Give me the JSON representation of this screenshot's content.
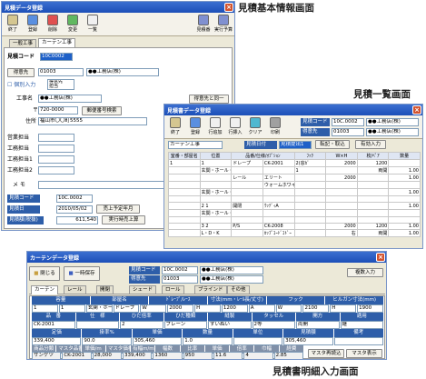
{
  "captions": {
    "master": "見積基本情報画面",
    "list": "見積一覧画面",
    "detail": "見積書明細入力画面"
  },
  "win1": {
    "title": "見積データ登録",
    "toolbar": [
      "終了",
      "登録",
      "削除",
      "変更",
      "一覧"
    ],
    "toolbar_right": [
      "見積番",
      "実行予算"
    ],
    "tabs": [
      "一般工事",
      "カーテン工事"
    ],
    "estimate_label": "見積コード",
    "estimate_value": "10C0002",
    "orderer_label": "得意先",
    "orderer_code": "01003",
    "orderer_name": "●●工務店(株)",
    "ship_label": "個別入力",
    "ship_note": "得意先\n担当",
    "project_label": "工事名",
    "project_value": "●●工務店(株)",
    "same_button": "得意先と同一",
    "zip_prefix": "〒",
    "zip_value": "720-0000",
    "zip_button": "郵便番号検索",
    "addr_label": "住所",
    "addr_value": "福山市〇〇町5555",
    "staff": [
      "営業担当",
      "工務担当",
      "工務担当1",
      "工務担当2"
    ],
    "memo_label": "メ モ",
    "code_label": "見積コード",
    "code_value": "10C.0002",
    "date_label": "見積日",
    "date_value": "2010/05/02",
    "date_button": "売上予定年月",
    "amount_label": "見積額(税抜)",
    "amount_value": "611,540",
    "amount_button": "実行時売上算"
  },
  "win2": {
    "title": "見積書データ登録",
    "toolbar": [
      "終了",
      "登録",
      "行追加",
      "行挿入",
      "クリア",
      "印刷"
    ],
    "est_label": "見積コード",
    "est_value": "10C.0002",
    "est_name": "●●工務店(株)",
    "cust_label": "得意先",
    "cust_code": "01003",
    "cust_name": "●●工務店(株)",
    "tab": "カーテン工事",
    "est_date": "見積日付",
    "est_sel": "見積提出1",
    "row_btn": "転記・取込",
    "print_btn": "有効入力",
    "headers": [
      "室番・部屋名",
      "位置",
      "品番/仕様/ｵﾌﾟｼｮﾝ",
      "ﾌｯｸ",
      "W×H",
      "枚/ﾍﾟｱ",
      "数量"
    ],
    "rows": [
      [
        "1",
        "1 ",
        "ドレープ",
        "CK-2001",
        "2(窓ｶﾞ",
        "2000",
        "1200",
        ""
      ],
      [
        "",
        "玄関・ホール・階段",
        "",
        "",
        "1",
        "",
        "両開",
        "1.00"
      ],
      [
        "",
        "",
        "レール",
        "エリート",
        "",
        "2000",
        "",
        "1.00"
      ],
      [
        "",
        "",
        "",
        "ウォームホワイト",
        "",
        "",
        "",
        ""
      ],
      [
        "",
        "玄関・ホール・階段",
        "",
        "",
        "",
        "",
        "",
        "1.00"
      ],
      [
        "",
        "",
        "",
        "",
        " ",
        "",
        "",
        ""
      ],
      [
        "",
        "2  1",
        "開閉",
        "ｳｯﾃﾞｨA",
        "",
        "",
        "",
        "1.00"
      ],
      [
        "",
        "玄関・ホール・階段",
        "",
        "",
        "",
        "",
        "",
        ""
      ],
      [
        "",
        "",
        "",
        "",
        "",
        "",
        "",
        ""
      ],
      [
        "",
        "3  2",
        "P/S",
        "CK-2008",
        "",
        "2000",
        "1200",
        "1.00"
      ],
      [
        "",
        "L・D・K",
        "",
        "ｶｯﾌﾟｺｰﾄﾞｺﾄﾞｰ",
        "",
        "右",
        "両開",
        "1.00"
      ]
    ]
  },
  "win3": {
    "title": "カーテンデータ登録",
    "close": "閉じる",
    "save": "一時保存",
    "est_label": "見積コード",
    "est_value": "10C.0002",
    "est_name": "●●工務店(株)",
    "cust_label": "得意先",
    "cust_code": "01003",
    "cust_name": "●●工務店(株)",
    "copy_btn": "複数入力",
    "tabs": [
      "カーテン",
      "レール",
      "開閉",
      "シェード",
      "ロール",
      "ブラインド",
      "その他"
    ],
    "h1": [
      "容量",
      "部屋名",
      "ﾄﾞﾚｰﾌﾟ/ﾚｰｽ",
      "寸法(mm・ﾚｰﾙ長/丈寸)",
      "フック",
      "ヒルガン寸法(mm)"
    ],
    "r1": [
      "1",
      "1",
      "玄関・ホール・階段",
      "ドレープ",
      "W",
      "2000",
      "H",
      "1200",
      "A",
      "W",
      "2100",
      "H",
      "1900"
    ],
    "h2": [
      "品　番",
      "仕　様",
      "ひだ倍率",
      "ひだ種類",
      "縫製",
      "タッセル",
      "開方",
      "適用"
    ],
    "r2": [
      "CK-2001",
      "",
      "2",
      "プレーン",
      "すいぬい",
      "2等",
      "両開",
      "継"
    ],
    "h3": [
      "定価",
      "掛率%",
      "単価",
      "数量",
      "単位",
      "見積額",
      "備考"
    ],
    "r3": [
      "339,400",
      "90.0",
      "305,460",
      "1.0",
      "",
      "305,460",
      ""
    ],
    "h4": [
      "商品分類",
      "マスタ品番",
      "単価/m",
      "マスタ価格",
      "有幅m/m",
      "幅数",
      "比率",
      "単価",
      "倍率",
      "巾幅",
      "経費"
    ],
    "r4": [
      "サンゲツ",
      "CK-2001",
      "28,000",
      "339,400",
      "1360",
      "950",
      "11.6",
      "4",
      "2.85"
    ],
    "b1": "マスタ再読込",
    "b2": "マスタ表示"
  }
}
